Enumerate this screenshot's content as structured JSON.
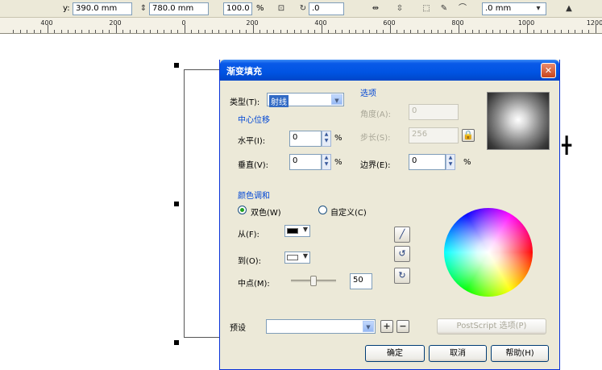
{
  "propbar": {
    "y_label": "y:",
    "y_value": "390.0 mm",
    "h_value": "780.0 mm",
    "scale_value": "100.0",
    "scale_unit": "%",
    "rotation_value": ".0",
    "outline_width": ".0 mm"
  },
  "ruler": {
    "labels": [
      "400",
      "200",
      "0",
      "200",
      "400",
      "600",
      "800",
      "1000",
      "1200"
    ]
  },
  "dialog": {
    "title": "渐变填充",
    "close_glyph": "✕",
    "type_label": "类型(T):",
    "type_value": "射线",
    "center_offset_group": "中心位移",
    "horizontal_label": "水平(I):",
    "horizontal_value": "0",
    "vertical_label": "垂直(V):",
    "vertical_value": "0",
    "percent": "%",
    "options_group": "选项",
    "angle_label": "角度(A):",
    "angle_value": "0",
    "steps_label": "步长(S):",
    "steps_value": "256",
    "edge_pad_label": "边界(E):",
    "edge_pad_value": "0",
    "color_blend_group": "颜色调和",
    "two_color_label": "双色(W)",
    "custom_label": "自定义(C)",
    "from_label": "从(F):",
    "from_color": "#000000",
    "to_label": "到(O):",
    "to_color": "#ffffff",
    "midpoint_label": "中点(M):",
    "midpoint_value": "50",
    "midpoint_fraction": 0.5,
    "presets_label": "预设",
    "presets_value": "",
    "postscript_button": "PostScript 选项(P)",
    "ok_button": "确定",
    "cancel_button": "取消",
    "help_button": "帮助(H)"
  },
  "colors": {
    "titlebar": "#0054e3",
    "dialog_bg": "#ece9d8",
    "group_text": "#0046d5"
  }
}
